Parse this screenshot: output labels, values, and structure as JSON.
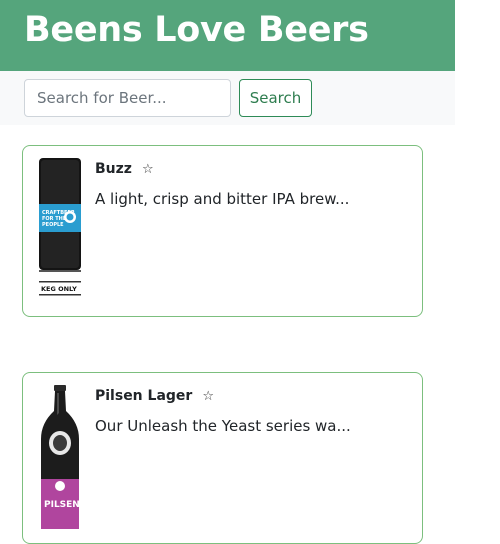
{
  "app": {
    "title": "Beens Love Beers"
  },
  "search": {
    "placeholder": "Search for Beer...",
    "value": "",
    "button_label": "Search"
  },
  "beers": [
    {
      "name": "Buzz",
      "favorite_icon": "☆",
      "description": "A light, crisp and bitter IPA brew...",
      "image_label": "KEG ONLY",
      "image_text": "CRAFTBEER FOR THE PEOPLE"
    },
    {
      "name": "Pilsen Lager",
      "favorite_icon": "☆",
      "description": "Our Unleash the Yeast series wa...",
      "image_label": "PILSEN"
    }
  ],
  "colors": {
    "header_bg": "#55a57c",
    "searchbar_bg": "#f8f9fa",
    "accent": "#2e8b57",
    "card_border": "#7cbf7e"
  }
}
